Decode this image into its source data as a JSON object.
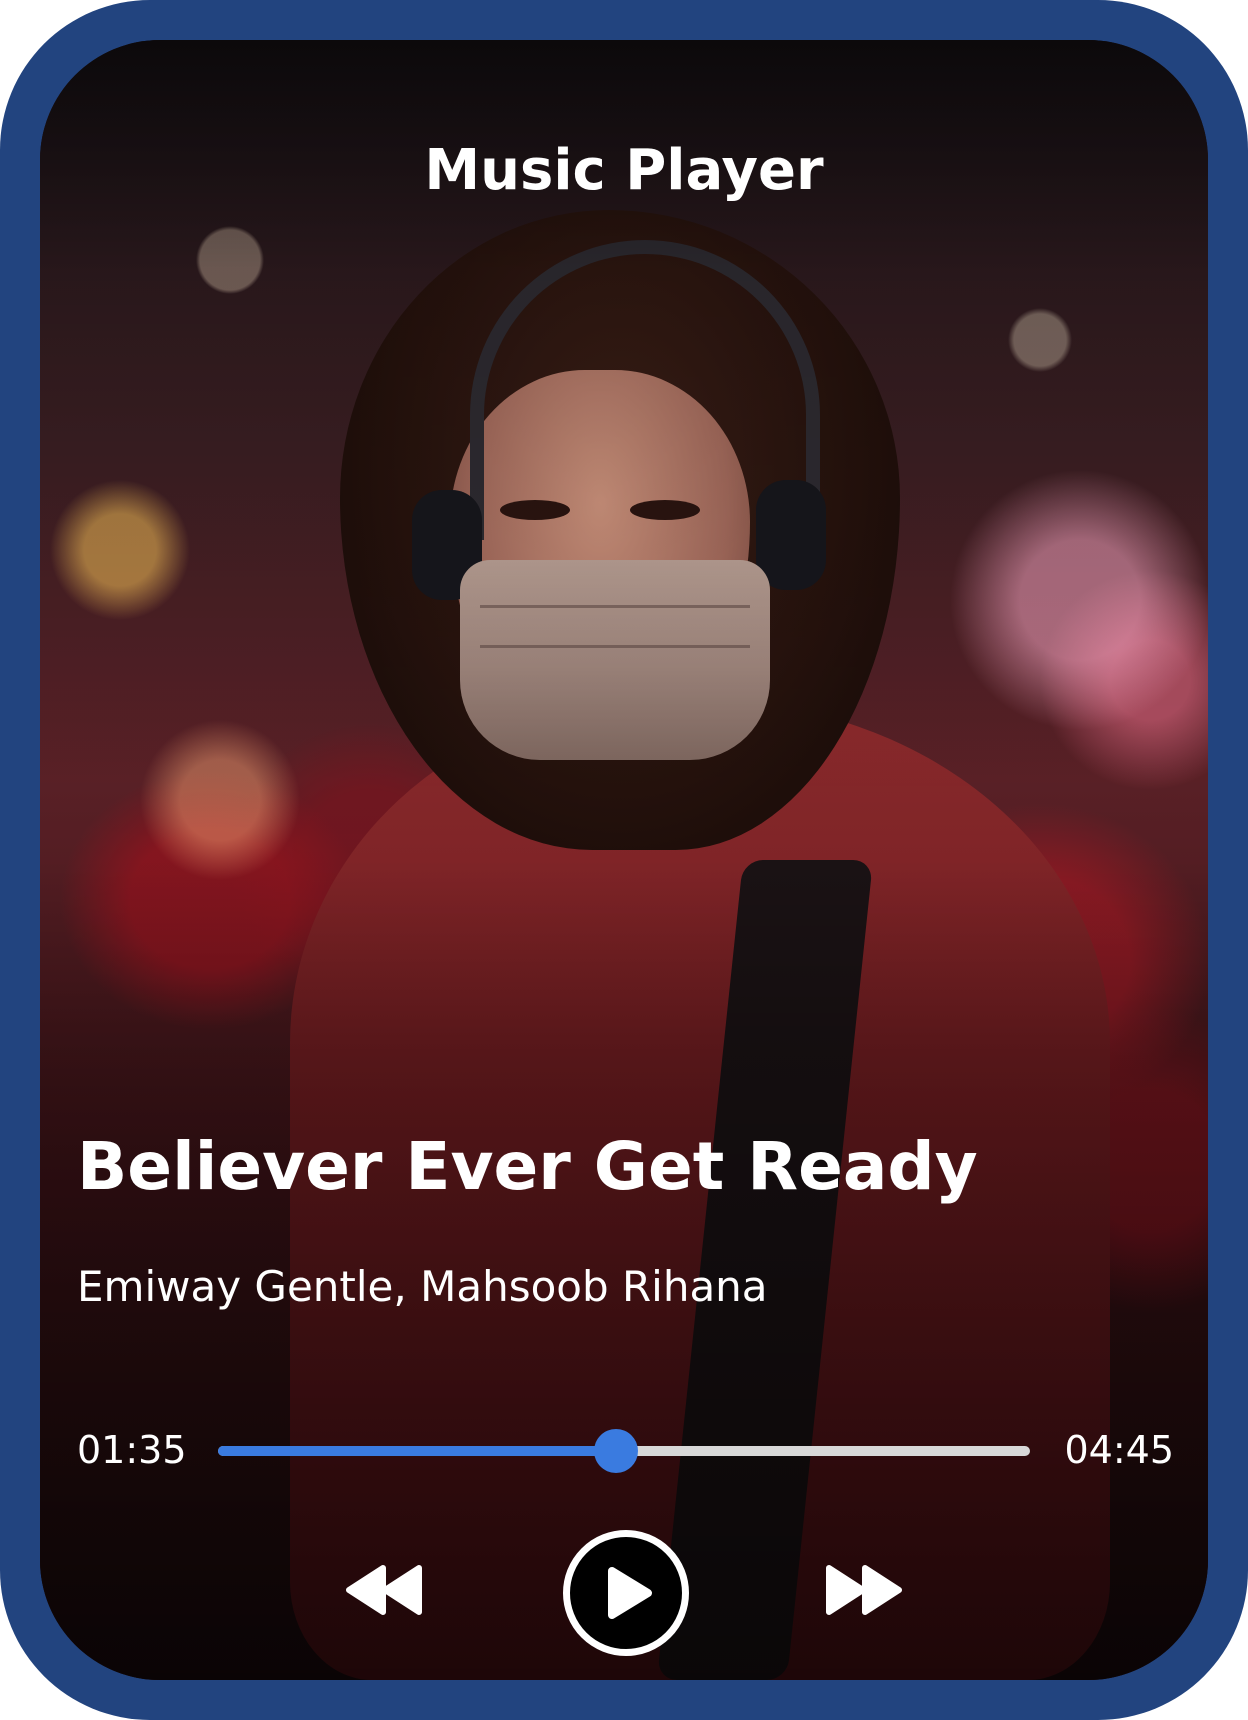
{
  "header": {
    "title": "Music Player"
  },
  "track": {
    "title": "Believer Ever Get Ready",
    "artists": "Emiway Gentle, Mahsoob Rihana"
  },
  "progress": {
    "current_time": "01:35",
    "total_time": "04:45",
    "fraction": 0.49
  },
  "controls": {
    "rewind_icon": "rewind-icon",
    "play_icon": "play-icon",
    "forward_icon": "fast-forward-icon"
  },
  "colors": {
    "frame": "#22447f",
    "accent": "#3a7be0",
    "track": "#d8d8d8",
    "text": "#ffffff"
  }
}
